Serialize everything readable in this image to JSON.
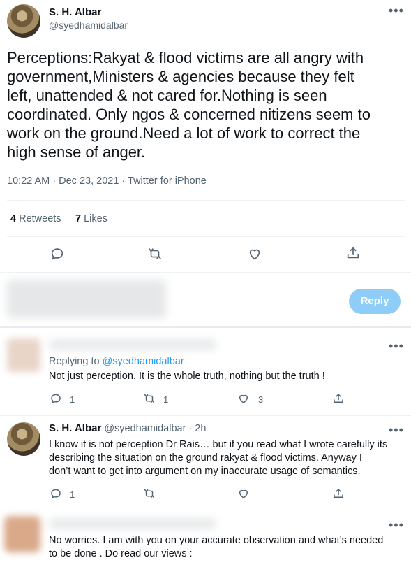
{
  "main_tweet": {
    "author_name": "S. H. Albar",
    "author_handle": "@syedhamidalbar",
    "text": "Perceptions:Rakyat & flood victims are all angry with government,Ministers & agencies because they felt left, unattended & not cared for.Nothing is seen coordinated. Only ngos & concerned nitizens seem to work on the ground.Need a lot of work to correct the high sense of anger.",
    "text_lines": [
      "Perceptions:Rakyat & flood victims are all angry with",
      "government,Ministers & agencies because they felt",
      "left, unattended & not cared for.Nothing is seen",
      "coordinated. Only ngos & concerned nitizens seem to",
      "work on the ground.Need a lot of work to correct the",
      "high sense of anger."
    ],
    "timestamp": "10:22 AM · Dec 23, 2021 · Twitter for iPhone",
    "retweets_count": "4",
    "retweets_label": "Retweets",
    "likes_count": "7",
    "likes_label": "Likes"
  },
  "composer": {
    "reply_button": "Reply"
  },
  "replies": [
    {
      "replying_to_label": "Replying to",
      "replying_to_handle": "@syedhamidalbar",
      "text": "Not just perception. It is the whole truth, nothing but the truth !",
      "reply_count": "1",
      "retweet_count": "1",
      "like_count": "3"
    },
    {
      "author_name": "S. H. Albar",
      "author_handle": "@syedhamidalbar",
      "time": "· 2h",
      "text_lines": [
        "I know it is not perception Dr Rais… but if you read what I wrote carefully its",
        "describing the situation on the ground rakyat & flood victims. Anyway I",
        "don’t want to get into argument on my inaccurate usage of semantics."
      ],
      "reply_count": "1"
    },
    {
      "text_lines": [
        "No worries. I am with you on your accurate observation and what’s needed",
        "to be done . Do read our views :"
      ]
    }
  ],
  "more_glyph": "•••",
  "icons": [
    "reply-icon",
    "retweet-icon",
    "like-icon",
    "share-icon",
    "more-icon"
  ],
  "colors": {
    "accent": "#1d9bf0",
    "reply_button_bg": "#8ecdf8",
    "muted": "#536471"
  }
}
